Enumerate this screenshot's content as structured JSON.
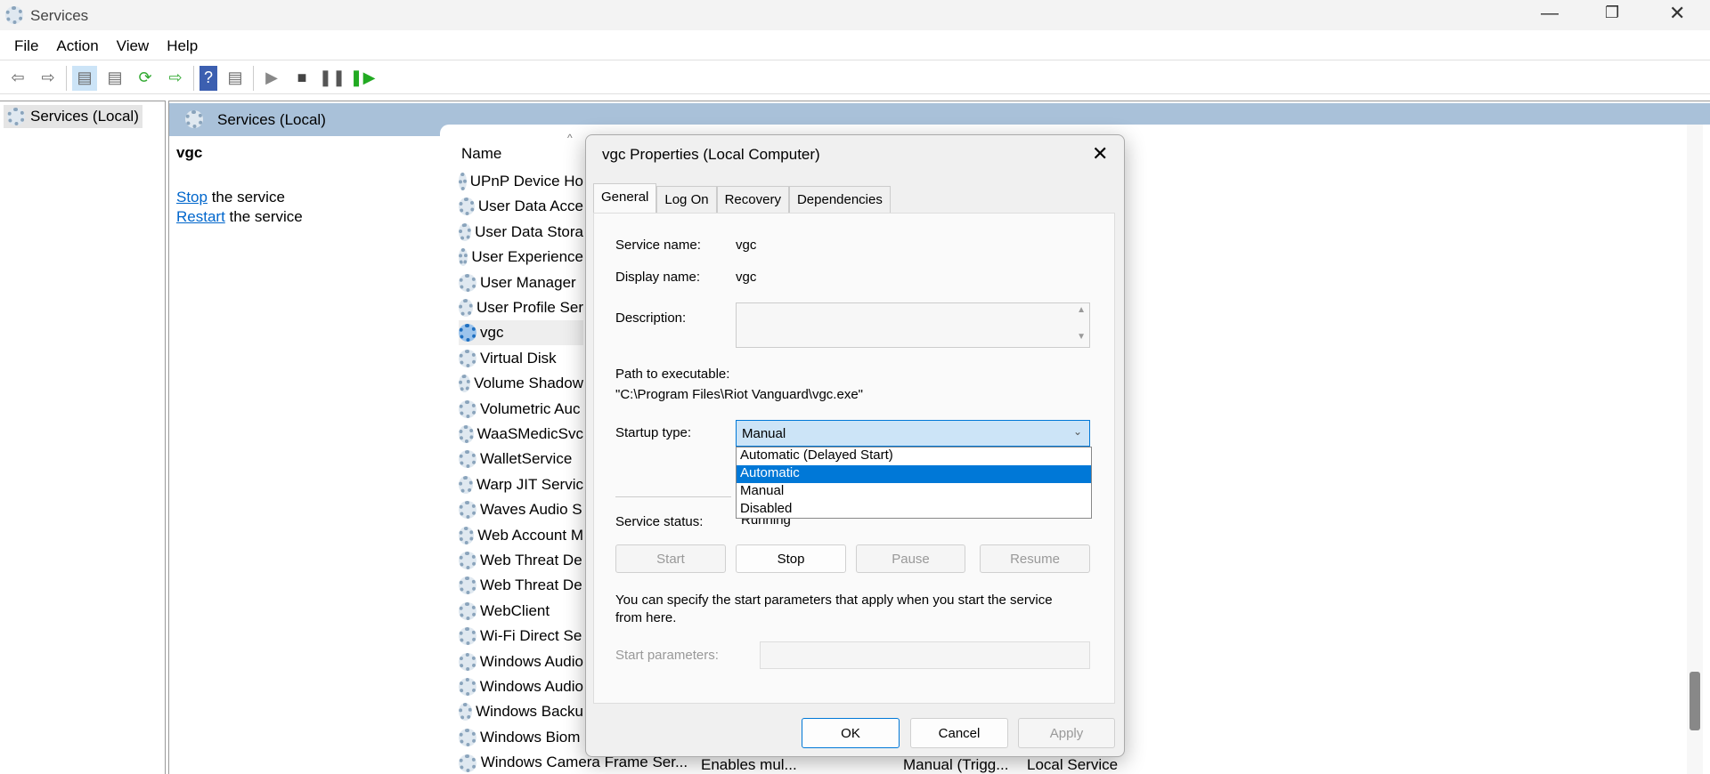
{
  "window": {
    "title": "Services",
    "controls": [
      "minimize",
      "restore",
      "close"
    ]
  },
  "menu": [
    "File",
    "Action",
    "View",
    "Help"
  ],
  "toolbar": [
    "back",
    "forward",
    "show-hide-tree",
    "properties",
    "refresh",
    "export-list",
    "help",
    "show-action-pane",
    "start",
    "stop",
    "pause",
    "resume"
  ],
  "tree": {
    "item": "Services (Local)"
  },
  "pane": {
    "header": "Services (Local)",
    "selected": "vgc",
    "stop_link": "Stop",
    "stop_rest": " the service",
    "restart_link": "Restart",
    "restart_rest": " the service",
    "name_col": "Name"
  },
  "services": [
    "UPnP Device Ho",
    "User Data Acce",
    "User Data Stora",
    "User Experience",
    "User Manager",
    "User Profile Ser",
    "vgc",
    "Virtual Disk",
    "Volume Shadow",
    "Volumetric Auc",
    "WaaSMedicSvc",
    "WalletService",
    "Warp JIT Servic",
    "Waves Audio S",
    "Web Account M",
    "Web Threat De",
    "Web Threat De",
    "WebClient",
    "Wi-Fi Direct Se",
    "Windows Audio",
    "Windows Audio",
    "Windows Backu",
    "Windows Biom"
  ],
  "last_row": {
    "name": "Windows Camera Frame Ser...",
    "description": "Enables mul...",
    "startup": "Manual (Trigg...",
    "logon": "Local Service"
  },
  "dialog": {
    "title": "vgc Properties (Local Computer)",
    "tabs": [
      "General",
      "Log On",
      "Recovery",
      "Dependencies"
    ],
    "service_name_label": "Service name:",
    "service_name": "vgc",
    "display_name_label": "Display name:",
    "display_name": "vgc",
    "description_label": "Description:",
    "path_label": "Path to executable:",
    "path": "\"C:\\Program Files\\Riot Vanguard\\vgc.exe\"",
    "startup_label": "Startup type:",
    "startup_value": "Manual",
    "startup_options": [
      "Automatic (Delayed Start)",
      "Automatic",
      "Manual",
      "Disabled"
    ],
    "highlighted_option": "Automatic",
    "status_label": "Service status:",
    "status": "Running",
    "buttons": {
      "start": "Start",
      "stop": "Stop",
      "pause": "Pause",
      "resume": "Resume"
    },
    "help_text": "You can specify the start parameters that apply when you start the service from here.",
    "params_label": "Start parameters:",
    "ok": "OK",
    "cancel": "Cancel",
    "apply": "Apply"
  },
  "colors": {
    "accent": "#0078d7",
    "band": "#a9c1d9"
  }
}
